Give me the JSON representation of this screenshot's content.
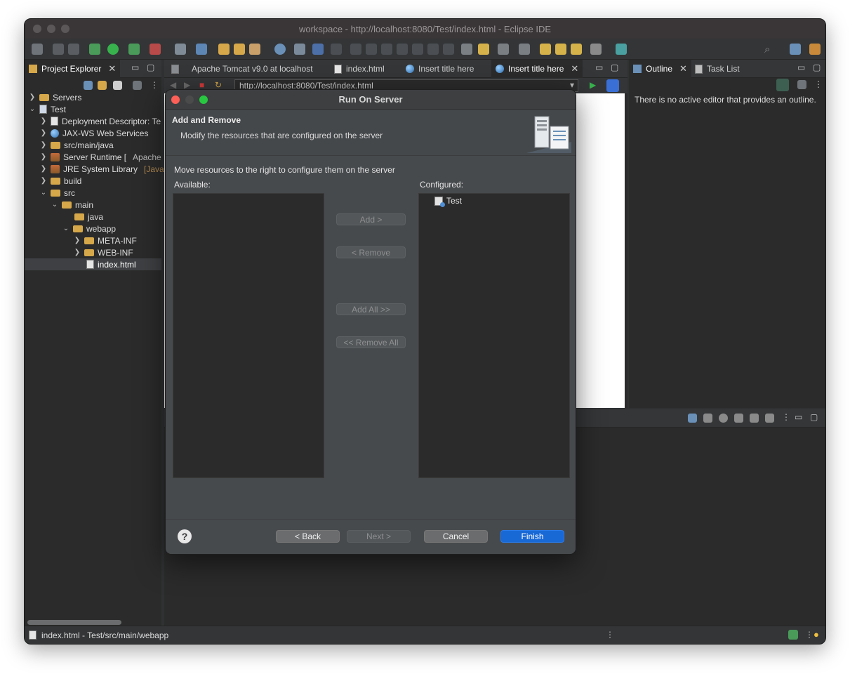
{
  "window": {
    "title": "workspace - http://localhost:8080/Test/index.html - Eclipse IDE"
  },
  "project_explorer": {
    "tab_label": "Project Explorer",
    "items": [
      {
        "label": "Servers"
      },
      {
        "label": "Test"
      },
      {
        "label": "Deployment Descriptor: Te"
      },
      {
        "label": "JAX-WS Web Services"
      },
      {
        "label": "src/main/java"
      },
      {
        "label": "Server Runtime [",
        "extra": "Apache"
      },
      {
        "label": "JRE System Library",
        "extra": "[JavaS"
      },
      {
        "label": "build"
      },
      {
        "label": "src"
      },
      {
        "label": "main"
      },
      {
        "label": "java"
      },
      {
        "label": "webapp"
      },
      {
        "label": "META-INF"
      },
      {
        "label": "WEB-INF"
      },
      {
        "label": "index.html"
      }
    ]
  },
  "editor": {
    "tabs": [
      {
        "label": "Apache Tomcat v9.0 at localhost"
      },
      {
        "label": "index.html"
      },
      {
        "label": "Insert title here"
      },
      {
        "label": "Insert title here"
      }
    ],
    "url": "http://localhost:8080/Test/index.html"
  },
  "outline": {
    "tabs": [
      {
        "label": "Outline"
      },
      {
        "label": "Task List"
      }
    ],
    "message": "There is no active editor that provides an outline."
  },
  "status": {
    "text": "index.html - Test/src/main/webapp"
  },
  "dialog": {
    "title": "Run On Server",
    "header_title": "Add and Remove",
    "header_subtitle": "Modify the resources that are configured on the server",
    "instruction": "Move resources to the right to configure them on the server",
    "available_label": "Available:",
    "configured_label": "Configured:",
    "configured_items": [
      "Test"
    ],
    "buttons": {
      "add": "Add >",
      "remove": "< Remove",
      "add_all": "Add All >>",
      "remove_all": "<< Remove All",
      "back": "< Back",
      "next": "Next >",
      "cancel": "Cancel",
      "finish": "Finish",
      "help": "?"
    }
  },
  "colors": {
    "accent": "#1868d6",
    "close": "#ff5f57",
    "minimize": "#4b4b4b",
    "zoom": "#28c840"
  }
}
